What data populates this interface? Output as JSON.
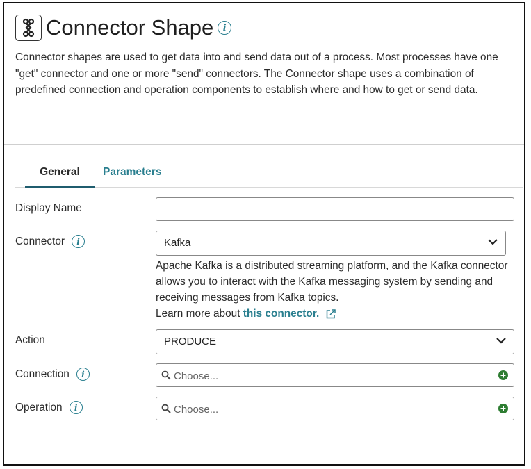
{
  "header": {
    "icon": "connector-shape-icon",
    "title": "Connector Shape",
    "description": "Connector shapes are used to get data into and send data out of a process. Most processes have one \"get\" connector and one or more \"send\" connectors. The Connector shape uses a combination of predefined connection and operation components to establish where and how to get or send data."
  },
  "tabs": [
    {
      "label": "General",
      "active": true
    },
    {
      "label": "Parameters",
      "active": false
    }
  ],
  "form": {
    "display_name": {
      "label": "Display Name",
      "value": ""
    },
    "connector": {
      "label": "Connector",
      "value": "Kafka",
      "help": "Apache Kafka is a distributed streaming platform, and the Kafka connector allows you to interact with the Kafka messaging system by sending and receiving messages from Kafka topics.",
      "learn_more_prefix": "Learn more about",
      "learn_more_link": "this connector."
    },
    "action": {
      "label": "Action",
      "value": "PRODUCE"
    },
    "connection": {
      "label": "Connection",
      "placeholder": "Choose..."
    },
    "operation": {
      "label": "Operation",
      "placeholder": "Choose..."
    }
  },
  "colors": {
    "accent": "#2a7f8f",
    "add_button": "#2e7d32",
    "active_tab_underline": "#1f5c6e"
  }
}
